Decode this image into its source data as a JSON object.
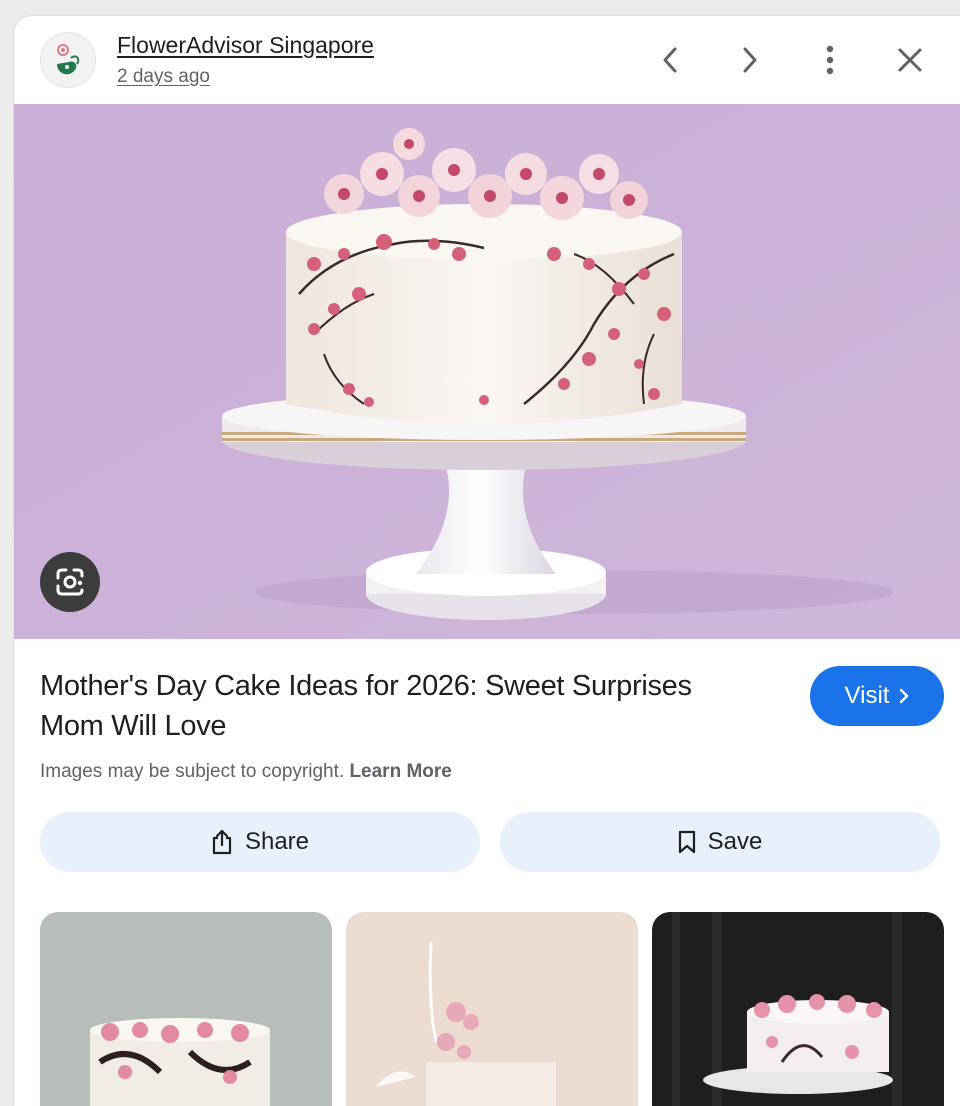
{
  "header": {
    "source_name": "FlowerAdvisor Singapore",
    "posted": "2 days ago",
    "avatar_icon": "floweradvisor-logo",
    "prev_icon": "chevron-left-icon",
    "next_icon": "chevron-right-icon",
    "more_icon": "more-vert-icon",
    "close_icon": "close-icon"
  },
  "hero": {
    "lens_icon": "google-lens-icon",
    "background_color": "#cdb3d8"
  },
  "info": {
    "title": "Mother's Day Cake Ideas for 2026: Sweet Surprises Mom Will Love",
    "visit_label": "Visit",
    "copyright_text": "Images may be subject to copyright.",
    "learn_more": "Learn More"
  },
  "actions": {
    "share_label": "Share",
    "save_label": "Save"
  },
  "colors": {
    "accent": "#1a73e8",
    "pill_bg": "#e8f0fc"
  }
}
